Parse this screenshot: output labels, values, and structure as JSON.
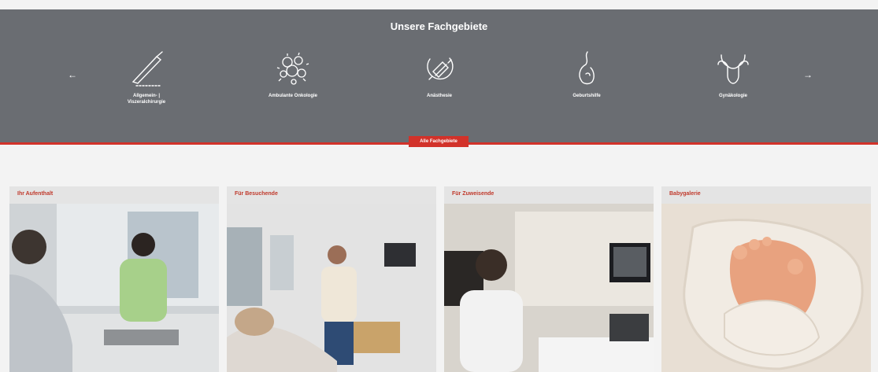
{
  "specialties": {
    "title": "Unsere Fachgebiete",
    "prev_arrow": "←",
    "next_arrow": "→",
    "items": [
      {
        "label": "Allgemein- |\nViszeralchirurgie",
        "icon": "scalpel-icon"
      },
      {
        "label": "Ambulante Onkologie",
        "icon": "cells-icon"
      },
      {
        "label": "Anästhesie",
        "icon": "syringe-icon"
      },
      {
        "label": "Geburtshilfe",
        "icon": "pregnancy-icon"
      },
      {
        "label": "Gynäkologie",
        "icon": "uterus-icon"
      }
    ],
    "all_button": "Alle Fachgebiete"
  },
  "cards": [
    {
      "title": "Ihr Aufenthalt"
    },
    {
      "title": "Für Besuchende"
    },
    {
      "title": "Für Zuweisende"
    },
    {
      "title": "Babygalerie"
    }
  ],
  "colors": {
    "band": "#6a6d72",
    "accent": "#d2322a",
    "background": "#f3f3f3"
  }
}
